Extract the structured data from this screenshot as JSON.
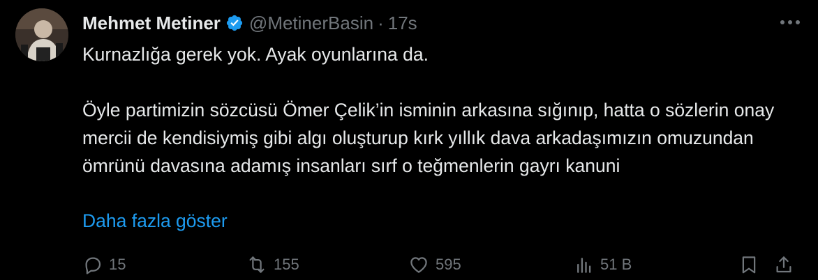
{
  "tweet": {
    "author_name": "Mehmet Metiner",
    "handle": "@MetinerBasin",
    "separator": "·",
    "time": "17s",
    "text_line1": "Kurnazlığa gerek yok. Ayak oyunlarına da.",
    "text_para2": "Öyle partimizin sözcüsü Ömer Çelik’in isminin arkasına sığınıp, hatta o sözlerin onay mercii de kendisiymiş gibi algı oluşturup kırk yıllık dava arkadaşımızın omuzundan ömrünü davasına adamış insanları sırf o teğmenlerin gayrı kanuni",
    "show_more": "Daha fazla göster"
  },
  "actions": {
    "replies": "15",
    "reposts": "155",
    "likes": "595",
    "views": "51 B"
  },
  "colors": {
    "background": "#000000",
    "text": "#e7e9ea",
    "secondary": "#71767b",
    "accent": "#1d9bf0"
  },
  "icons": [
    "verified-badge-icon",
    "more-options-icon",
    "reply-icon",
    "repost-icon",
    "like-icon",
    "views-icon",
    "bookmark-icon",
    "share-icon"
  ]
}
